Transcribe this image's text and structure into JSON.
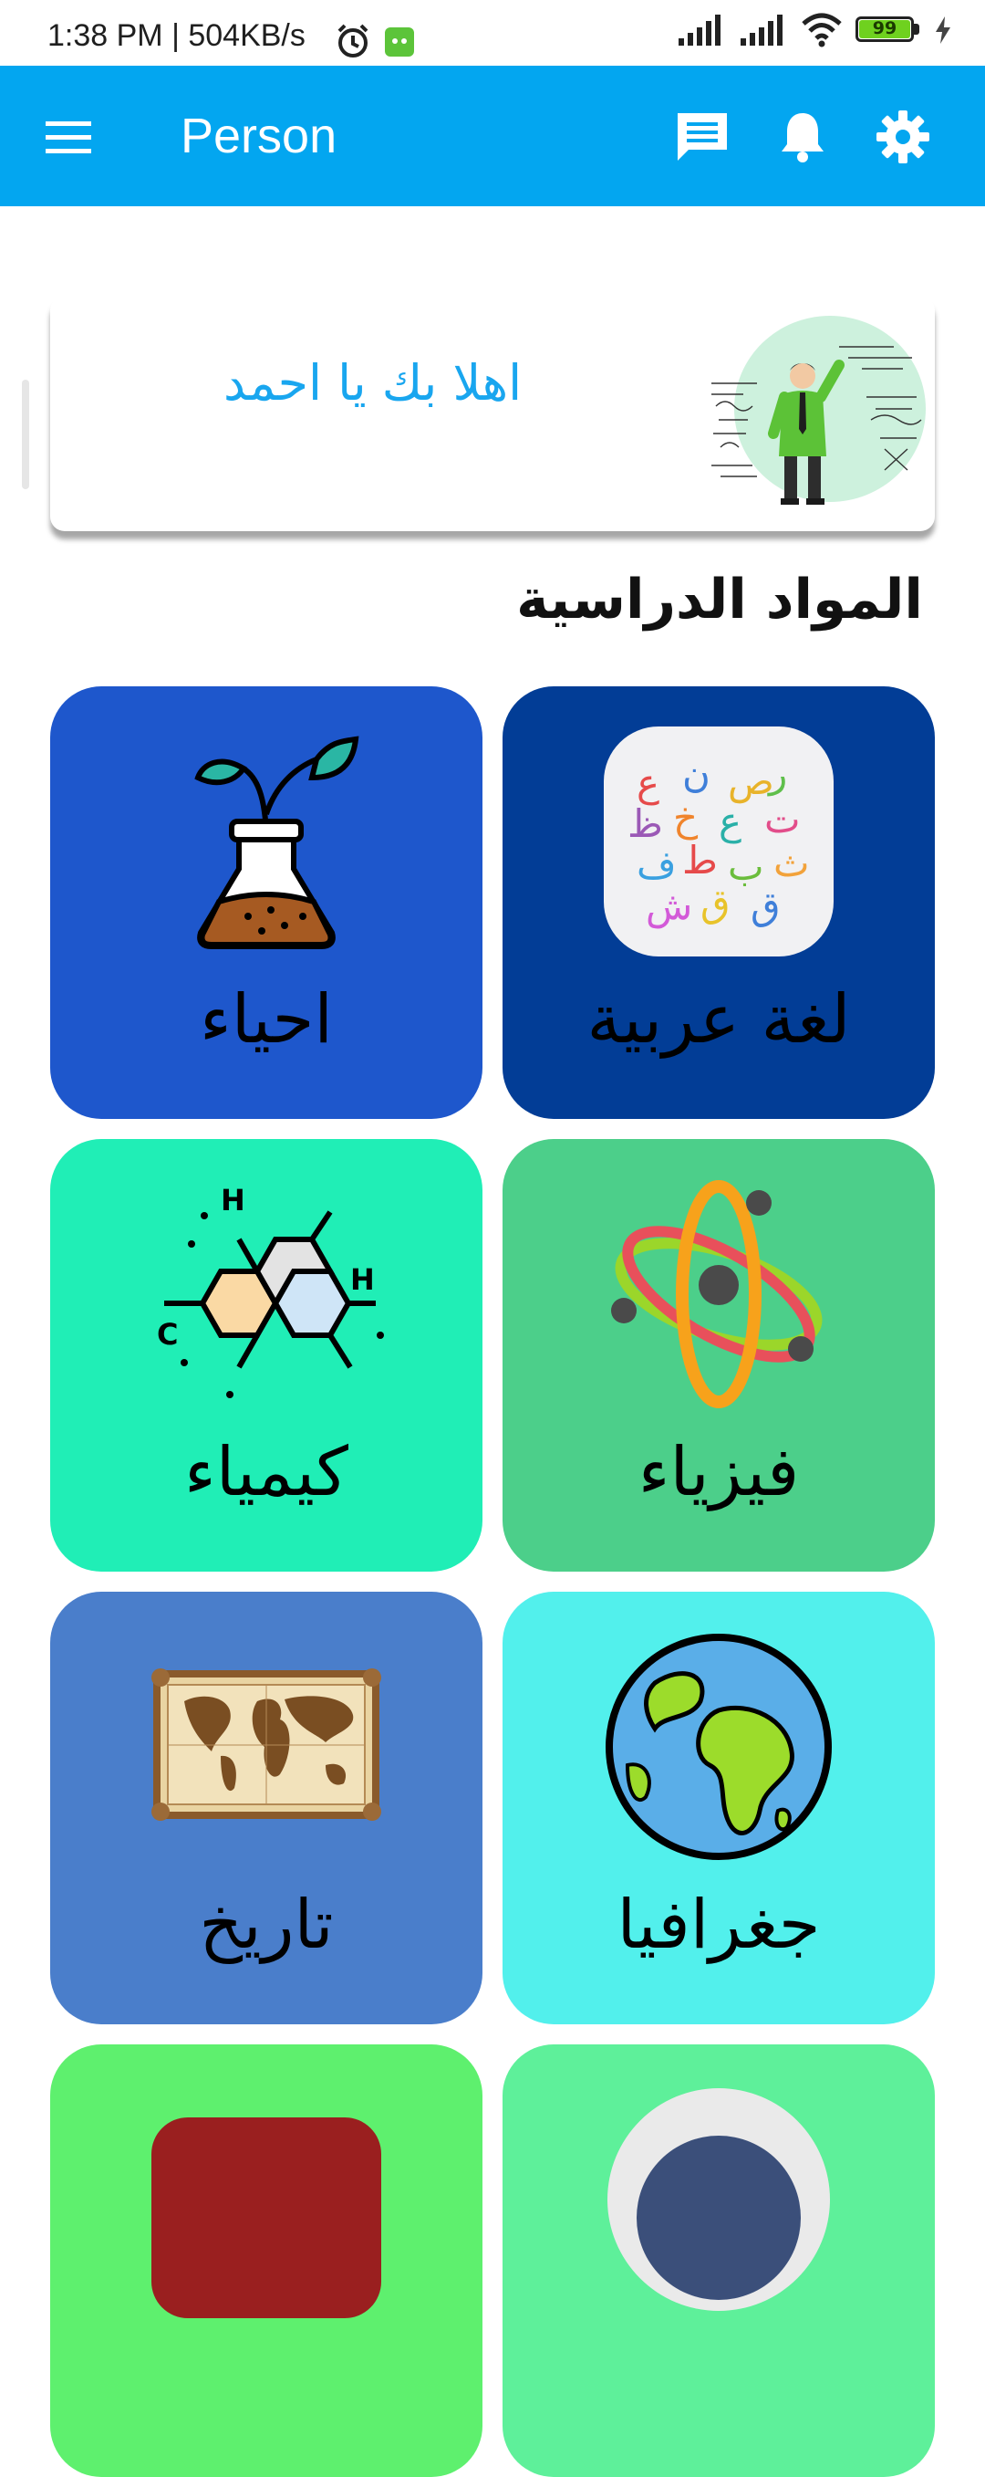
{
  "status_bar": {
    "time": "1:38 PM | 504KB/s",
    "battery": "99"
  },
  "app_bar": {
    "title": "Person"
  },
  "welcome": {
    "greeting": "اهلا بك يا احمد"
  },
  "section": {
    "title": "المواد الدراسية"
  },
  "subjects": [
    {
      "label": "لغة عربية",
      "color": "#023d96",
      "icon": "arabic-letters-icon"
    },
    {
      "label": "احياء",
      "color": "#1e57cc",
      "icon": "plant-flask-icon"
    },
    {
      "label": "فيزياء",
      "color": "#4ccf8a",
      "icon": "atom-icon"
    },
    {
      "label": "كيمياء",
      "color": "#20eeb6",
      "icon": "molecule-icon"
    },
    {
      "label": "جغرافيا",
      "color": "#52f0ec",
      "icon": "globe-icon"
    },
    {
      "label": "تاريخ",
      "color": "#4a7ecb",
      "icon": "old-map-icon"
    },
    {
      "label": "",
      "color": "#5ef09a",
      "icon": "partial-icon"
    },
    {
      "label": "",
      "color": "#5ef06e",
      "icon": "partial-icon"
    }
  ]
}
